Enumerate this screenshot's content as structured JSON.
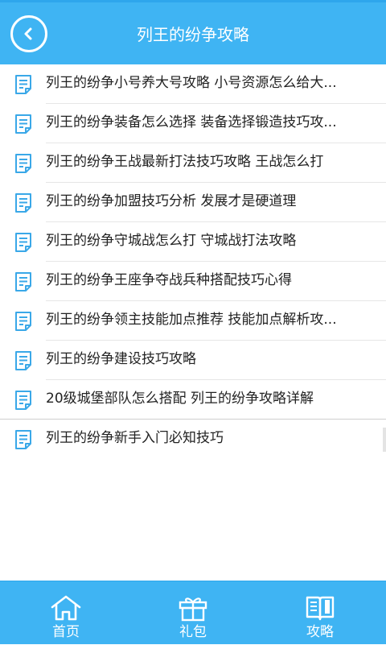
{
  "header": {
    "title": "列王的纷争攻略",
    "back_icon": "back-arrow-icon"
  },
  "articles": [
    {
      "title": "列王的纷争小号养大号攻略 小号资源怎么给大..."
    },
    {
      "title": "列王的纷争装备怎么选择 装备选择锻造技巧攻..."
    },
    {
      "title": "列王的纷争王战最新打法技巧攻略 王战怎么打"
    },
    {
      "title": "列王的纷争加盟技巧分析 发展才是硬道理"
    },
    {
      "title": "列王的纷争守城战怎么打 守城战打法攻略"
    },
    {
      "title": "列王的纷争王座争夺战兵种搭配技巧心得"
    },
    {
      "title": "列王的纷争领主技能加点推荐 技能加点解析攻..."
    },
    {
      "title": "列王的纷争建设技巧攻略"
    },
    {
      "title": "20级城堡部队怎么搭配 列王的纷争攻略详解"
    },
    {
      "title": "列王的纷争新手入门必知技巧"
    }
  ],
  "tabbar": {
    "tabs": [
      {
        "label": "首页",
        "icon": "home-icon"
      },
      {
        "label": "礼包",
        "icon": "gift-icon"
      },
      {
        "label": "攻略",
        "icon": "book-icon"
      }
    ]
  },
  "colors": {
    "accent": "#3fb4f3",
    "icon_blue": "#3aa8e8",
    "text": "#222222"
  }
}
